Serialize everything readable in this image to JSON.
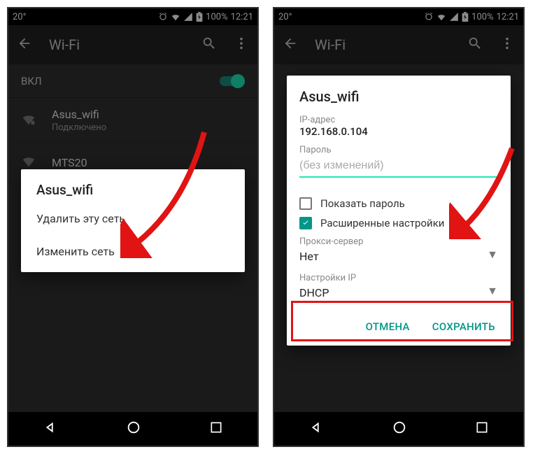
{
  "statusbar": {
    "temperature": "20°",
    "battery": "100%",
    "time": "12:21"
  },
  "appbar": {
    "title": "Wi-Fi"
  },
  "wifi_toggle_label": "ВКЛ",
  "networks": [
    {
      "name": "Asus_wifi",
      "status": "Подключено"
    },
    {
      "name": "MTS20",
      "status": ""
    }
  ],
  "context_menu": {
    "title": "Asus_wifi",
    "delete": "Удалить эту сеть",
    "modify": "Изменить сеть"
  },
  "edit_dialog": {
    "title": "Asus_wifi",
    "ip_label": "IP-адрес",
    "ip_value": "192.168.0.104",
    "password_label": "Пароль",
    "password_placeholder": "(без изменений)",
    "show_password": "Показать пароль",
    "advanced": "Расширенные настройки",
    "proxy_label": "Прокси-сервер",
    "proxy_value": "Нет",
    "ip_settings_label": "Настройки IP",
    "ip_settings_value": "DHCP",
    "cancel": "ОТМЕНА",
    "save": "СОХРАНИТЬ"
  }
}
